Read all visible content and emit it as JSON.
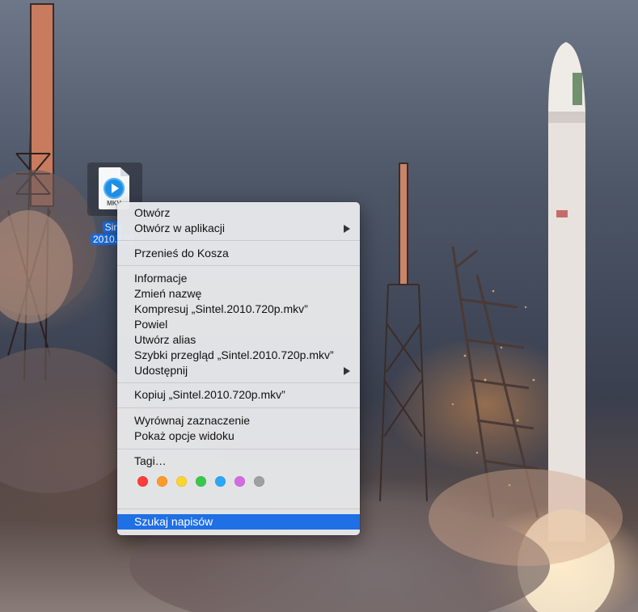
{
  "desktop": {
    "file": {
      "icon_label": "MKV",
      "name_line1": "Sint",
      "name_line2": "2010.720"
    }
  },
  "context_menu": {
    "items": {
      "open": "Otwórz",
      "open_with": "Otwórz w aplikacji",
      "move_to_trash": "Przenieś do Kosza",
      "get_info": "Informacje",
      "rename": "Zmień nazwę",
      "compress": "Kompresuj „Sintel.2010.720p.mkv”",
      "duplicate": "Powiel",
      "make_alias": "Utwórz alias",
      "quick_look": "Szybki przegląd „Sintel.2010.720p.mkv”",
      "share": "Udostępnij",
      "copy": "Kopiuj „Sintel.2010.720p.mkv”",
      "clean_up": "Wyrównaj zaznaczenie",
      "view_options": "Pokaż opcje widoku",
      "tags": "Tagi…",
      "find_subtitles": "Szukaj napisów"
    },
    "tag_colors": [
      {
        "name": "red",
        "hex": "#fc3d39"
      },
      {
        "name": "orange",
        "hex": "#fd9a29"
      },
      {
        "name": "yellow",
        "hex": "#fed330"
      },
      {
        "name": "green",
        "hex": "#39c84a"
      },
      {
        "name": "blue",
        "hex": "#2aa8f6"
      },
      {
        "name": "purple",
        "hex": "#d66ae2"
      },
      {
        "name": "gray",
        "hex": "#a0a0a3"
      }
    ],
    "highlight_color": "#1f6fe5"
  }
}
